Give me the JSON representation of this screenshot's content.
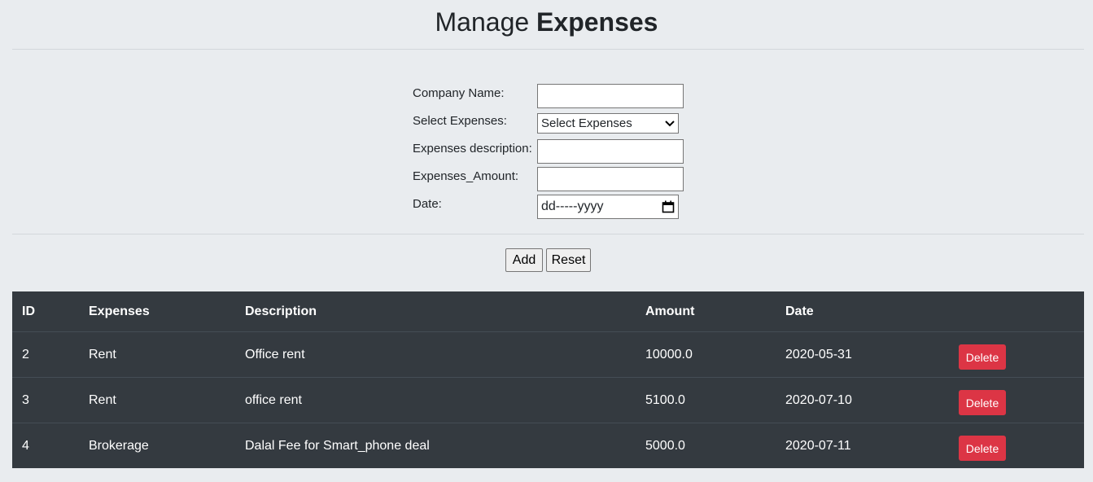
{
  "page": {
    "title_regular": "Manage",
    "title_bold": "Expenses"
  },
  "form": {
    "company_label": "Company Name:",
    "company_value": "",
    "expense_type_label": "Select Expenses:",
    "expense_type_selected": "Select Expenses",
    "description_label": "Expenses description:",
    "description_value": "",
    "amount_label": "Expenses_Amount:",
    "amount_value": "",
    "date_label": "Date:",
    "date_placeholder": "dd-----yyyy",
    "add_label": "Add",
    "reset_label": "Reset"
  },
  "table": {
    "headers": [
      "ID",
      "Expenses",
      "Description",
      "Amount",
      "Date",
      ""
    ],
    "rows": [
      {
        "id": "2",
        "expense": "Rent",
        "description": "Office rent",
        "amount": "10000.0",
        "date": "2020-05-31",
        "action": "Delete"
      },
      {
        "id": "3",
        "expense": "Rent",
        "description": "office rent",
        "amount": "5100.0",
        "date": "2020-07-10",
        "action": "Delete"
      },
      {
        "id": "4",
        "expense": "Brokerage",
        "description": "Dalal Fee for Smart_phone deal",
        "amount": "5000.0",
        "date": "2020-07-11",
        "action": "Delete"
      }
    ]
  },
  "icons": {
    "select_arrow": "chevron-down-icon",
    "date_picker": "calendar-icon"
  },
  "colors": {
    "background": "#e9ecef",
    "table_bg": "#343a40",
    "delete_button": "#dc3545"
  }
}
